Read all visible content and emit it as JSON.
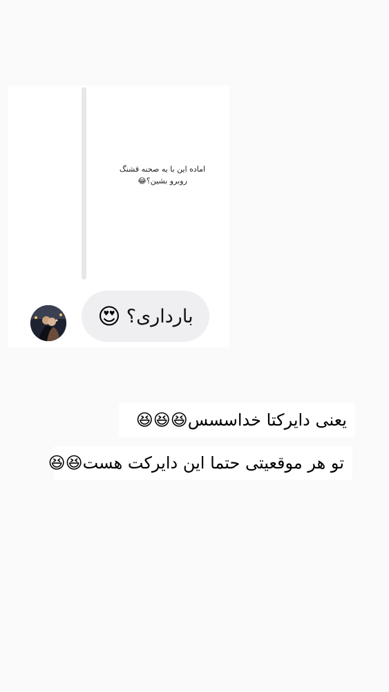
{
  "quoted_story": {
    "line1": "اماده این با یه صحنه قشنگ",
    "line2": "روبرو بشین؟😂"
  },
  "message": {
    "text": "بارداری؟",
    "emoji": "😍"
  },
  "captions": [
    {
      "text": "یعنی دایرکتا خداسسس",
      "emoji": "😆😆😆"
    },
    {
      "text": "تو هر موقعیتی حتما این دایرکت هست",
      "emoji": "😆😆"
    }
  ],
  "colors": {
    "background": "#fafafa",
    "bubble": "#efeff1",
    "reply_bar": "#e6e7ea"
  }
}
